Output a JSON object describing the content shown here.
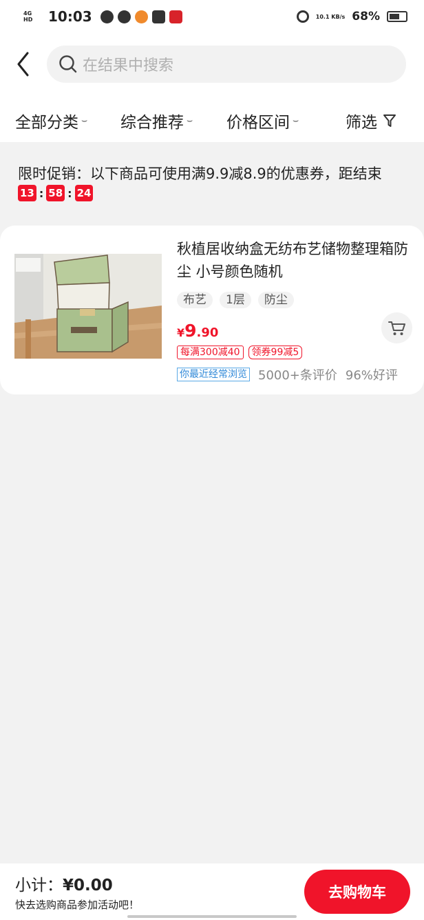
{
  "status_bar": {
    "network": "4G HD",
    "time": "10:03",
    "net_speed": "10.1 KB/s",
    "battery": "68%"
  },
  "search": {
    "placeholder": "在结果中搜索"
  },
  "filters": [
    {
      "label": "全部分类"
    },
    {
      "label": "综合推荐"
    },
    {
      "label": "价格区间"
    },
    {
      "label": "筛选"
    }
  ],
  "promo": {
    "text": "限时促销：以下商品可使用满9.9减8.9的优惠券，距结束",
    "countdown": {
      "hours": "13",
      "minutes": "58",
      "seconds": "24"
    }
  },
  "product": {
    "title": "秋植居收纳盒无纺布艺储物整理箱防尘 小号颜色随机",
    "tags": [
      "布艺",
      "1层",
      "防尘"
    ],
    "price": {
      "symbol": "¥",
      "integer": "9",
      "decimal": ".90"
    },
    "coupons": [
      "每满300减40",
      "领券99减5"
    ],
    "recent_badge": "你最近经常浏览",
    "reviews": "5000+条评价",
    "good_rate": "96%好评"
  },
  "footer": {
    "subtotal_label": "小计：",
    "subtotal_amount": "¥0.00",
    "hint": "快去选购商品参加活动吧！",
    "checkout_label": "去购物车"
  },
  "colors": {
    "accent": "#f0142a",
    "background": "#f2f2f2",
    "badge_blue": "#2f88d8"
  }
}
